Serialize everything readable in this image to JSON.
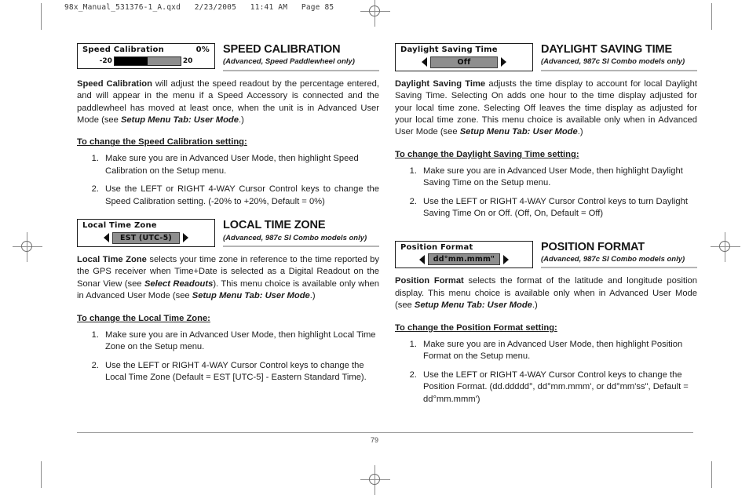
{
  "slug": "98x_Manual_531376-1_A.qxd   2/23/2005   11:41 AM   Page 85",
  "footer": {
    "page_number": "79"
  },
  "colors": {
    "lcd_highlight": "#8e8e8e",
    "lcd_fill": "#000000",
    "rule": "#b4b4b4",
    "text": "#1d1d1d"
  },
  "sections": [
    {
      "id": "speed-calibration",
      "title": "SPEED CALIBRATION",
      "subtitle": "(Advanced, Speed Paddlewheel only)",
      "widget": {
        "type": "slider",
        "label": "Speed Calibration",
        "value": "0%",
        "min_label": "-20",
        "max_label": "20",
        "fill_percent": 50
      },
      "body_html": "<b>Speed Calibration</b> will adjust the speed readout by the percentage entered, and will appear in the menu if a Speed Accessory is connected and the paddlewheel has moved at least once, when the unit is in Advanced User Mode (see <i>Setup Menu Tab: User Mode</i>.)",
      "howto": "To change the Speed Calibration setting:",
      "steps": [
        {
          "num": "1.",
          "text": "Make sure you are in Advanced User Mode, then highlight Speed Calibration on the Setup menu.",
          "justify": false
        },
        {
          "num": "2.",
          "text": "Use the LEFT or RIGHT 4-WAY Cursor Control keys to change the Speed Calibration setting. (-20% to +20%, Default = 0%)",
          "justify": true
        }
      ]
    },
    {
      "id": "local-time-zone",
      "title": "LOCAL TIME ZONE",
      "subtitle": "(Advanced, 987c SI Combo models only)",
      "widget": {
        "type": "spinner",
        "label": "Local Time Zone",
        "value": "EST (UTC-5)"
      },
      "body_html": "<b>Local Time Zone</b> selects your time zone in reference to the time reported by the GPS receiver when Time+Date is selected as a Digital Readout on the Sonar View (see <i>Select Readouts</i>). This menu choice is available only when in Advanced User Mode (see <i>Setup Menu Tab: User Mode</i>.)",
      "howto": "To change the Local Time Zone:",
      "steps": [
        {
          "num": "1.",
          "text": "Make sure you are in Advanced User Mode, then highlight Local Time Zone on the Setup menu.",
          "justify": false
        },
        {
          "num": "2.",
          "text": "Use the LEFT or RIGHT 4-WAY Cursor Control keys to change the Local Time Zone (Default = EST [UTC-5] - Eastern Standard Time).",
          "justify": false
        }
      ]
    },
    {
      "id": "daylight-saving-time",
      "title": "DAYLIGHT SAVING TIME",
      "subtitle": "(Advanced, 987c SI Combo models only)",
      "widget": {
        "type": "spinner",
        "label": "Daylight Saving Time",
        "value": "Off"
      },
      "body_html": "<b>Daylight Saving Time</b> adjusts the time display to account for local Daylight Saving Time. Selecting On adds one hour to the time display adjusted for your local time zone. Selecting Off leaves the time display as adjusted for your local time zone. This menu choice is available only when in Advanced User Mode (see <i>Setup Menu Tab: User Mode</i>.)",
      "howto": "To change the Daylight Saving Time setting:",
      "steps": [
        {
          "num": "1.",
          "text": "Make sure you are in Advanced User Mode, then highlight Daylight Saving Time on the Setup menu.",
          "justify": false
        },
        {
          "num": "2.",
          "text": "Use the LEFT or RIGHT 4-WAY Cursor Control keys to turn Daylight Saving Time On or Off. (Off, On, Default = Off)",
          "justify": false
        }
      ]
    },
    {
      "id": "position-format",
      "title": "POSITION FORMAT",
      "subtitle": "(Advanced, 987c SI Combo models only)",
      "widget": {
        "type": "spinner",
        "label": "Position Format",
        "value": "dd°mm.mmm\""
      },
      "body_html": "<b>Position Format</b> selects the format of the latitude and longitude position display.  This menu choice is available only when in Advanced User Mode (see <i>Setup Menu Tab: User Mode</i>.)",
      "howto": "To change the Position Format setting:",
      "steps": [
        {
          "num": "1.",
          "text": "Make sure you are in Advanced User Mode, then highlight Position Format on the Setup menu.",
          "justify": false
        },
        {
          "num": "2.",
          "text": "Use the LEFT or RIGHT 4-WAY Cursor Control keys to change the Position Format. (dd.ddddd°, dd°mm.mmm', or dd°mm'ss\", Default = dd°mm.mmm')",
          "justify": false
        }
      ]
    }
  ]
}
